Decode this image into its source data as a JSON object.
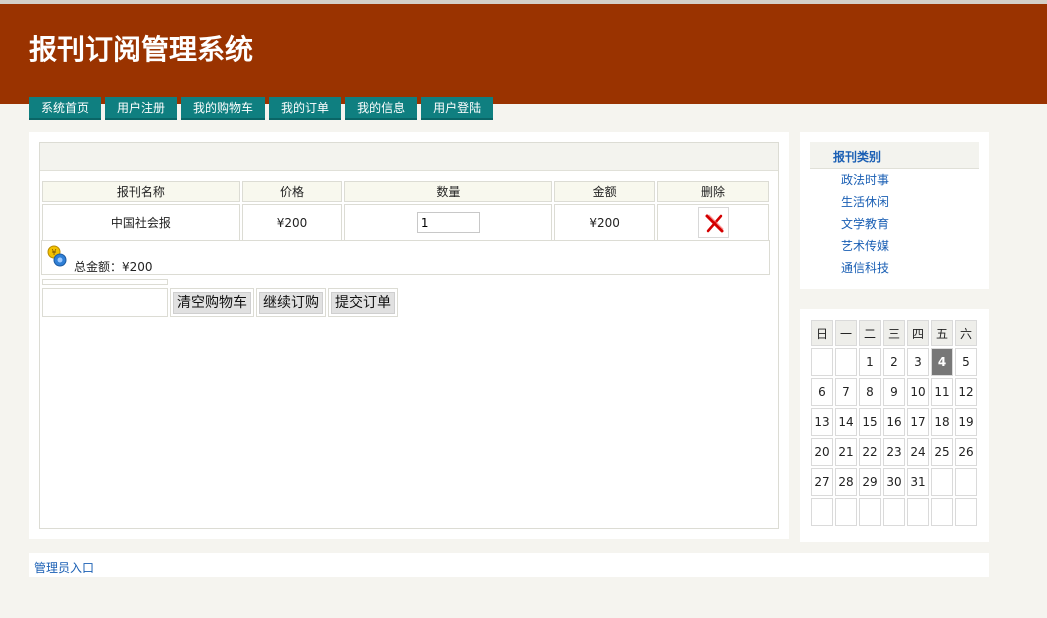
{
  "site": {
    "title": "报刊订阅管理系统"
  },
  "nav": [
    {
      "label": "系统首页"
    },
    {
      "label": "用户注册"
    },
    {
      "label": "我的购物车"
    },
    {
      "label": "我的订单"
    },
    {
      "label": "我的信息"
    },
    {
      "label": "用户登陆"
    }
  ],
  "cart": {
    "headers": [
      "报刊名称",
      "价格",
      "数量",
      "金额",
      "删除"
    ],
    "rows": [
      {
        "name": "中国社会报",
        "price": "¥200",
        "quantity": "1",
        "amount": "¥200",
        "delete_icon": "red-x-delete-icon"
      }
    ],
    "total_label": "总金额：¥200",
    "total_icon": "coin-money-icon",
    "buttons": {
      "clear": "清空购物车",
      "continue": "继续订购",
      "submit": "提交订单"
    }
  },
  "categories": {
    "title": "报刊类别",
    "items": [
      {
        "label": "政法时事"
      },
      {
        "label": "生活休闲"
      },
      {
        "label": "文学教育"
      },
      {
        "label": "艺术传媒"
      },
      {
        "label": "通信科技"
      }
    ]
  },
  "calendar": {
    "weekdays": [
      "日",
      "一",
      "二",
      "三",
      "四",
      "五",
      "六"
    ],
    "weeks": [
      [
        "",
        "",
        "1",
        "2",
        "3",
        "4",
        "5"
      ],
      [
        "6",
        "7",
        "8",
        "9",
        "10",
        "11",
        "12"
      ],
      [
        "13",
        "14",
        "15",
        "16",
        "17",
        "18",
        "19"
      ],
      [
        "20",
        "21",
        "22",
        "23",
        "24",
        "25",
        "26"
      ],
      [
        "27",
        "28",
        "29",
        "30",
        "31",
        "",
        ""
      ],
      [
        "",
        "",
        "",
        "",
        "",
        "",
        ""
      ]
    ],
    "today": "4"
  },
  "footer": {
    "admin_link": "管理员入口"
  },
  "colors": {
    "header": "#9a3300",
    "nav": "#0f7f80",
    "link": "#1a5fb4",
    "today_cell": "#777777"
  }
}
